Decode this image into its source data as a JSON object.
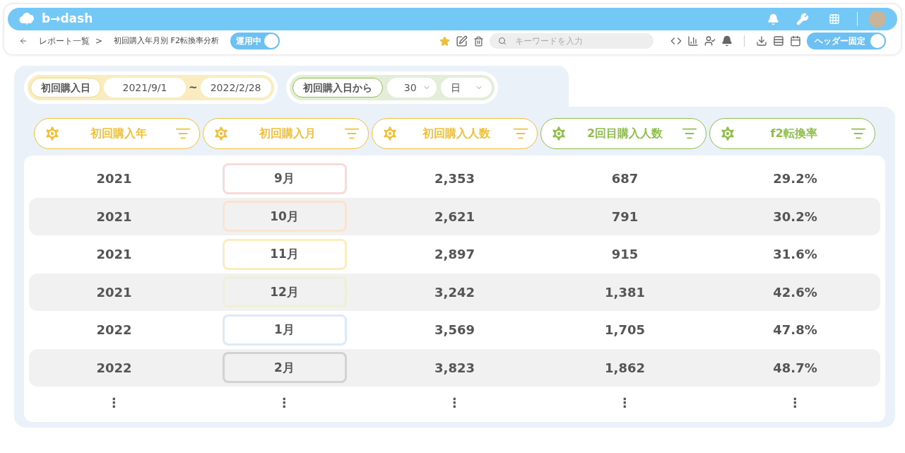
{
  "app_bar": {
    "logo": "b→dash"
  },
  "toolbar": {
    "breadcrumb": "レポート一覧",
    "separator": ">",
    "title": "初回購入年月別 F2転換率分析",
    "status_toggle": {
      "label": "運用中",
      "on": true
    },
    "search": {
      "placeholder": "キーワードを入力"
    },
    "header_toggle": {
      "label": "ヘッダー固定",
      "on": true
    }
  },
  "filters": {
    "date_range": {
      "label": "初回購入日",
      "from": "2021/9/1",
      "separator": "~",
      "to": "2022/2/28"
    },
    "period": {
      "label": "初回購入日から",
      "number": "30",
      "unit": "日"
    }
  },
  "columns": [
    {
      "label": "初回購入年",
      "color": "#f2bf3a"
    },
    {
      "label": "初回購入月",
      "color": "#f2bf3a"
    },
    {
      "label": "初回購入人数",
      "color": "#f2bf3a"
    },
    {
      "label": "2回目購入人数",
      "color": "#8fbf4a"
    },
    {
      "label": "f2転換率",
      "color": "#8fbf4a"
    }
  ],
  "rows": [
    {
      "year": "2021",
      "month": "9月",
      "color": "#f5dcd8",
      "first": "2,353",
      "second": "687",
      "rate": "29.2%"
    },
    {
      "year": "2021",
      "month": "10月",
      "color": "#fbe4cf",
      "first": "2,621",
      "second": "791",
      "rate": "30.2%"
    },
    {
      "year": "2021",
      "month": "11月",
      "color": "#fbedc0",
      "first": "2,897",
      "second": "915",
      "rate": "31.6%"
    },
    {
      "year": "2021",
      "month": "12月",
      "color": "#eef0d8",
      "first": "3,242",
      "second": "1,381",
      "rate": "42.6%"
    },
    {
      "year": "2022",
      "month": "1月",
      "color": "#dceaf8",
      "first": "3,569",
      "second": "1,705",
      "rate": "47.8%"
    },
    {
      "year": "2022",
      "month": "2月",
      "color": "#d2d2d2",
      "first": "3,823",
      "second": "1,862",
      "rate": "48.7%"
    }
  ],
  "more_row": [
    "⋮",
    "⋮",
    "⋮",
    "⋮",
    "⋮"
  ]
}
